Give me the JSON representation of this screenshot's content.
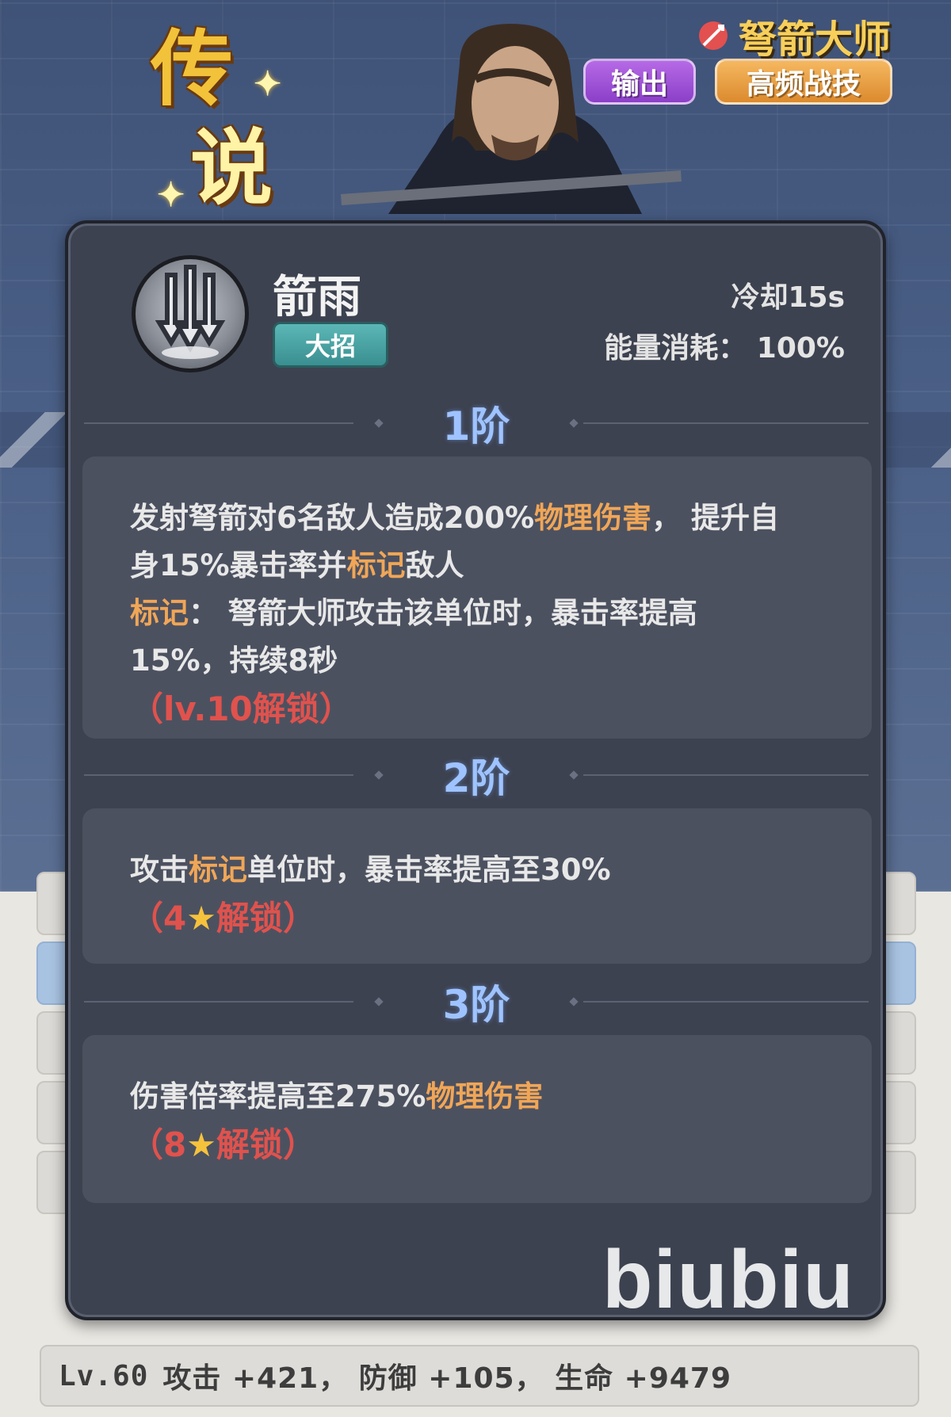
{
  "header": {
    "rarity_chars": [
      "传",
      "说"
    ],
    "hero_name": "弩箭大师",
    "role_tags": [
      "输出",
      "高频战技"
    ]
  },
  "skill": {
    "name": "箭雨",
    "type": "大招",
    "cooldown": "冷却15s",
    "energy_cost": "能量消耗： 100%",
    "icon": "arrow-rain-icon"
  },
  "tiers": [
    {
      "label": "1阶",
      "lines": [
        [
          {
            "t": "发射弩箭对6名敌人造成200%"
          },
          {
            "t": "物理伤害",
            "hl": true
          },
          {
            "t": "， 提升自"
          }
        ],
        [
          {
            "t": "身15%暴击率并"
          },
          {
            "t": "标记",
            "hl": true
          },
          {
            "t": "敌人"
          }
        ],
        [
          {
            "t": "标记",
            "hl": true
          },
          {
            "t": "： 弩箭大师攻击该单位时，暴击率提高"
          }
        ],
        [
          {
            "t": "15%，持续8秒"
          }
        ]
      ],
      "unlock": [
        "（lv.10",
        "解锁）"
      ]
    },
    {
      "label": "2阶",
      "lines": [
        [
          {
            "t": "攻击"
          },
          {
            "t": "标记",
            "hl": true
          },
          {
            "t": "单位时，暴击率提高至30%"
          }
        ]
      ],
      "unlock": [
        "（4",
        "★",
        "解锁）"
      ]
    },
    {
      "label": "3阶",
      "lines": [
        [
          {
            "t": "伤害倍率提高至275%"
          },
          {
            "t": "物理伤害",
            "hl": true
          }
        ]
      ],
      "unlock": [
        "（8",
        "★",
        "解锁）"
      ]
    }
  ],
  "levels": {
    "last_row": {
      "lv": "Lv.60",
      "text": "攻击 +421， 防御 +105， 生命 +9479"
    }
  },
  "watermark": "biubiu",
  "colors": {
    "highlight": "#f0a657",
    "unlock": "#e0524d",
    "tier_label": "#9fc3ff",
    "panel_bg": "#3d4250"
  }
}
